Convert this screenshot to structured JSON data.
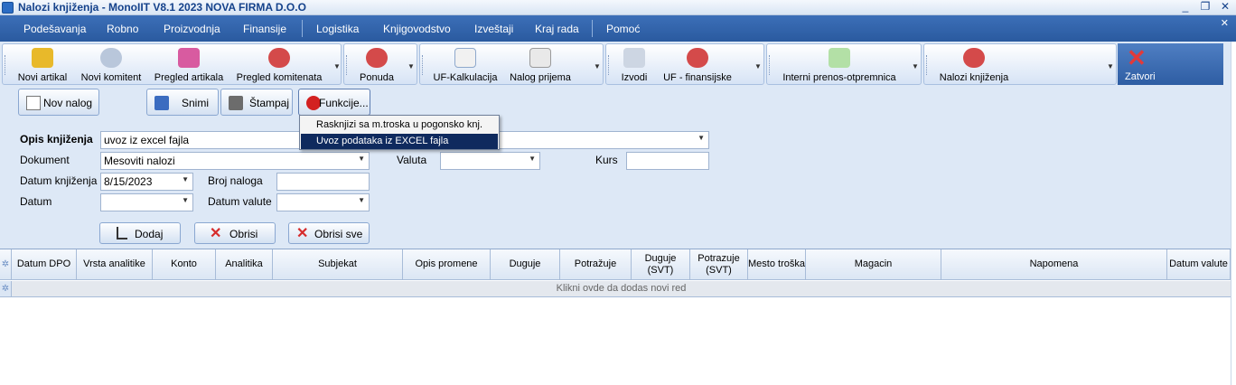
{
  "window": {
    "title": "Nalozi knjiženja - MonoIIT V8.1 2023 NOVA FIRMA D.O.O",
    "minimize": "_",
    "maximize": "❐",
    "close": "✕"
  },
  "menu": {
    "items": [
      "Podešavanja",
      "Robno",
      "Proizvodnja",
      "Finansije",
      "Logistika",
      "Knjigovodstvo",
      "Izveštaji",
      "Kraj rada",
      "Pomoć"
    ],
    "close": "✕"
  },
  "toolbar": {
    "buttons": [
      {
        "label": "Novi artikal",
        "icon": "lock-icon"
      },
      {
        "label": "Novi komitent",
        "icon": "add-user-icon"
      },
      {
        "label": "Pregled artikala",
        "icon": "articles-icon"
      },
      {
        "label": "Pregled komitenata",
        "icon": "clients-icon"
      },
      {
        "label": "Ponuda",
        "icon": "offer-icon"
      },
      {
        "label": "UF-Kalkulacija",
        "icon": "calculation-icon"
      },
      {
        "label": "Nalog prijema",
        "icon": "receipt-icon"
      },
      {
        "label": "Izvodi",
        "icon": "statements-icon"
      },
      {
        "label": "UF - finansijske",
        "icon": "finance-icon"
      },
      {
        "label": "Interni prenos-otpremnica",
        "icon": "transfer-icon"
      },
      {
        "label": "Nalozi knjiženja",
        "icon": "book-icon"
      }
    ],
    "close_label": "Zatvori"
  },
  "actions": {
    "new_order": "Nov nalog",
    "save": "Snimi",
    "print": "Štampaj",
    "functions": "Funkcije..."
  },
  "popup": {
    "items": [
      "Rasknjizi sa m.troska u pogonsko knj.",
      "Uvoz podataka iz  EXCEL fajla"
    ],
    "selected_index": 1
  },
  "form": {
    "opis_label": "Opis knjiženja",
    "opis_value": "uvoz iz excel fajla",
    "dokument_label": "Dokument",
    "dokument_value": "Mesoviti nalozi",
    "valuta_label": "Valuta",
    "valuta_value": "",
    "kurs_label": "Kurs",
    "kurs_value": "",
    "datum_knjizenja_label": "Datum knjiženja",
    "datum_knjizenja_value": "8/15/2023",
    "broj_naloga_label": "Broj naloga",
    "broj_naloga_value": "",
    "datum_label": "Datum",
    "datum_value": "",
    "datum_valute_label": "Datum valute",
    "datum_valute_value": ""
  },
  "row_actions": {
    "add": "Dodaj",
    "delete": "Obrisi",
    "delete_all": "Obrisi sve"
  },
  "grid": {
    "columns": [
      "Datum DPO",
      "Vrsta analitike",
      "Konto",
      "Analitika",
      "Subjekat",
      "Opis promene",
      "Duguje",
      "Potražuje",
      "Duguje (SVT)",
      "Potrazuje (SVT)",
      "Mesto troška",
      "Magacin",
      "Napomena",
      "Datum valute"
    ],
    "new_row_text": "Klikni ovde da dodas novi red"
  }
}
